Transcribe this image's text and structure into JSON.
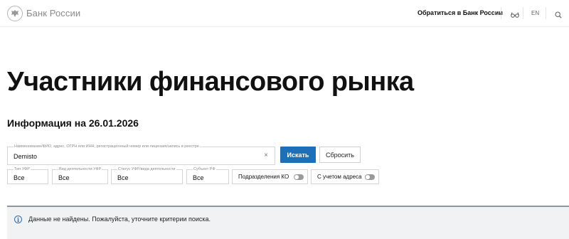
{
  "header": {
    "logo_text": "Банк России",
    "contact_label": "Обратиться в Банк России",
    "lang_label": "EN",
    "icons": [
      "bank-emblem-icon",
      "glasses-icon",
      "search-icon"
    ]
  },
  "page_title": "Участники финансового рынка",
  "subtitle": "Информация на 26.01.2026",
  "search": {
    "label": "Наименование/ФИО, адрес, ОГРН или ИНН, регистрационный номер или лицензия/запись в реестре",
    "value": "Demisto",
    "search_button": "Искать",
    "reset_button": "Сбросить"
  },
  "filters": {
    "type": {
      "label": "Тип УФР",
      "value": "Все"
    },
    "activity": {
      "label": "Вид деятельности УФР",
      "value": "Все"
    },
    "status": {
      "label": "Статус УФР/вида деятельности",
      "value": "Все"
    },
    "subject": {
      "label": "Субъект РФ",
      "value": "Все"
    },
    "branches_toggle": {
      "label": "Подразделения КО",
      "on": false
    },
    "address_toggle": {
      "label": "С учетом адреса",
      "on": false
    }
  },
  "notice": {
    "text": "Данные не найдены. Пожалуйста, уточните критерии поиска."
  },
  "colors": {
    "primary_button": "#1d6fb8",
    "notice_bg": "#f0f2f4",
    "notice_border": "#8b96a3"
  }
}
